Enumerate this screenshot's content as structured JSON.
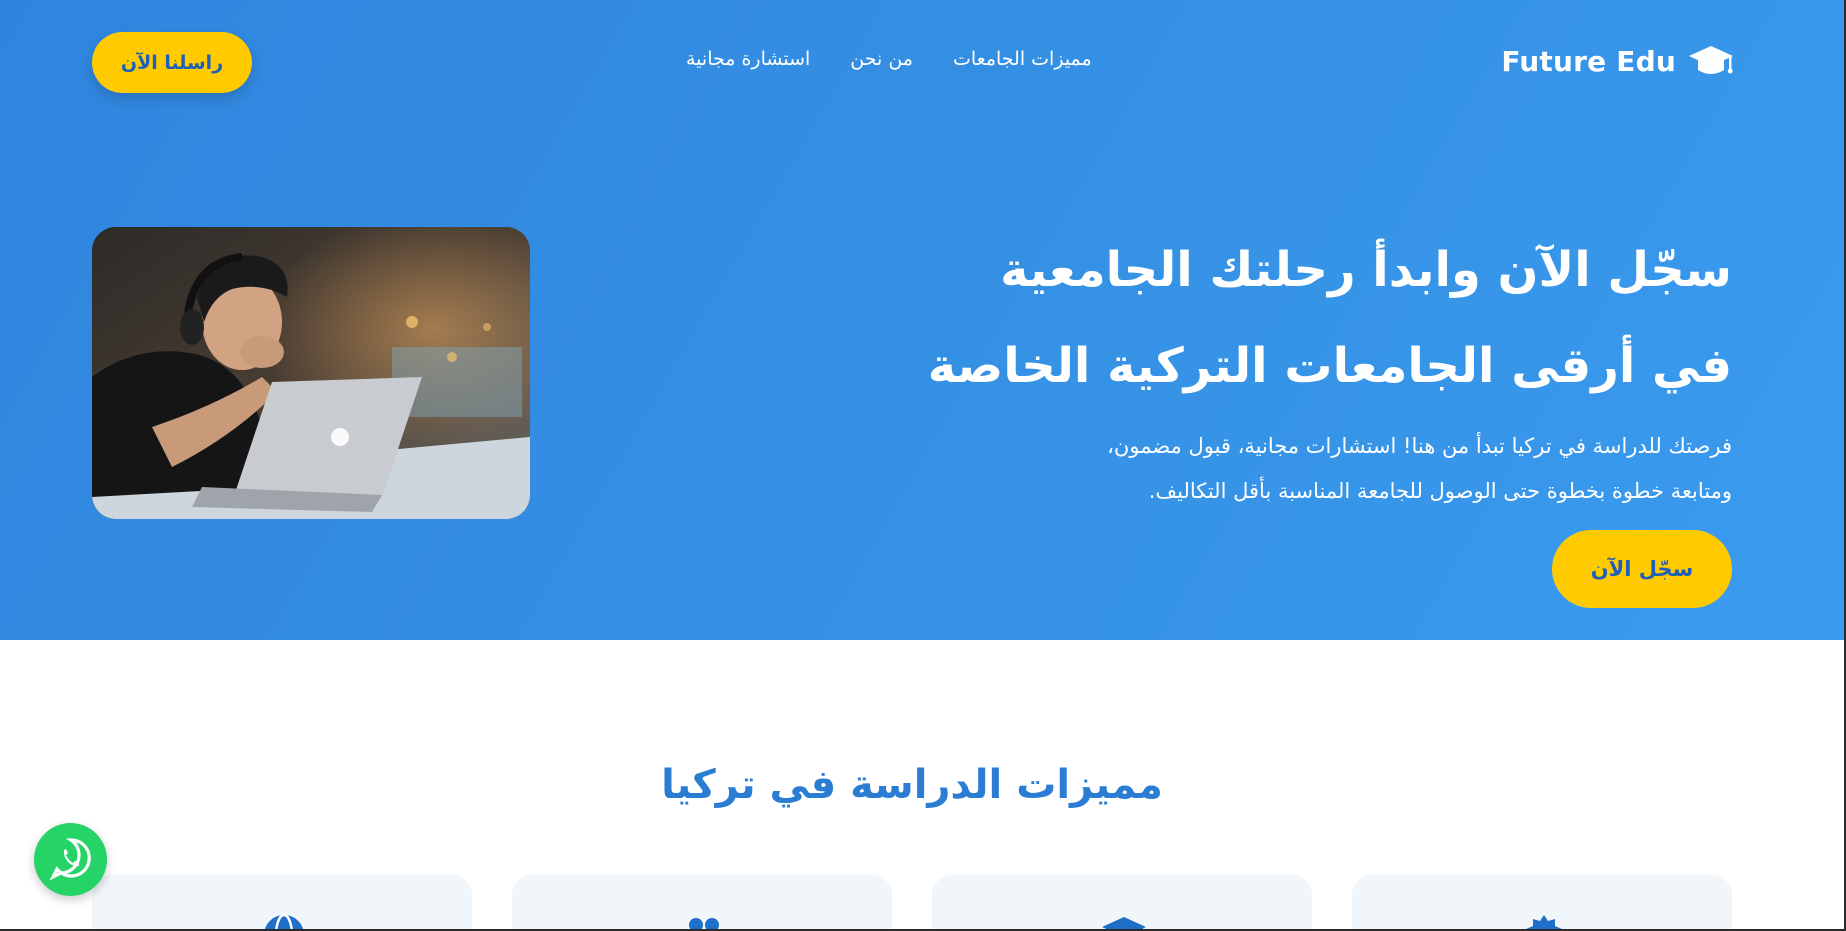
{
  "brand": {
    "name": "Future Edu",
    "icon": "graduation-cap-icon"
  },
  "nav": {
    "items": [
      {
        "label": "مميزات الجامعات"
      },
      {
        "label": "من نحن"
      },
      {
        "label": "استشارة مجانية"
      }
    ]
  },
  "header": {
    "cta_label": "راسلنا الآن"
  },
  "hero": {
    "title_line1": "سجّل الآن وابدأ رحلتك الجامعية",
    "title_line2": "في أرقى الجامعات التركية الخاصة",
    "subtitle_line1": "فرصتك للدراسة في تركيا تبدأ من هنا! استشارات مجانية، قبول مضمون،",
    "subtitle_line2": "ومتابعة خطوة بخطوة حتى الوصول للجامعة المناسبة بأقل التكاليف.",
    "cta_label": "سجّل الآن",
    "image": "student-with-laptop-photo"
  },
  "features": {
    "title": "مميزات الدراسة في تركيا",
    "cards": [
      {
        "icon": "award-icon"
      },
      {
        "icon": "graduation-cap-icon"
      },
      {
        "icon": "users-icon"
      },
      {
        "icon": "globe-icon"
      }
    ]
  },
  "floating": {
    "icon": "whatsapp-icon"
  },
  "colors": {
    "primary": "#2f85de",
    "accent": "#ffcb00",
    "accent_text": "#1e5fb8",
    "heading_blue": "#2b7cd3",
    "whatsapp": "#25d366",
    "card_bg": "#f1f6fb"
  }
}
